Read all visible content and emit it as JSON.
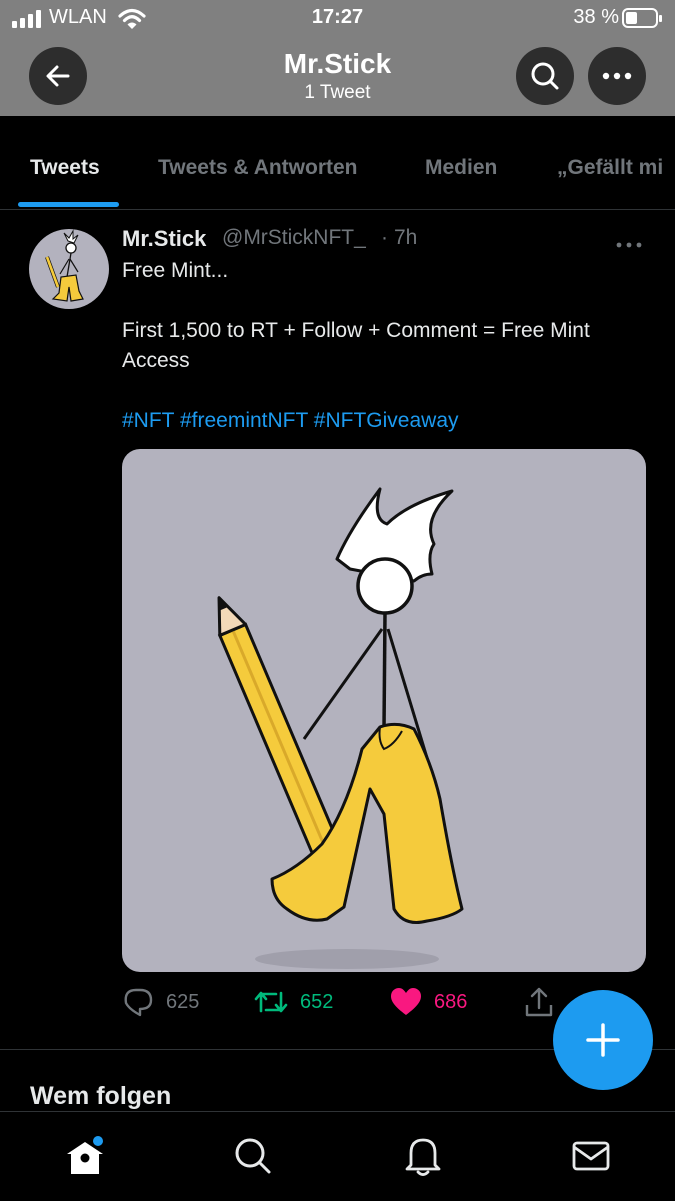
{
  "status_bar": {
    "carrier": "WLAN",
    "time": "17:27",
    "battery": "38 %"
  },
  "header": {
    "title": "Mr.Stick",
    "subtitle": "1 Tweet"
  },
  "tabs": [
    {
      "label": "Tweets",
      "active": true
    },
    {
      "label": "Tweets & Antworten",
      "active": false
    },
    {
      "label": "Medien",
      "active": false
    },
    {
      "label": "„Gefällt mi",
      "active": false
    }
  ],
  "tweet": {
    "author_name": "Mr.Stick",
    "author_handle": "@MrStickNFT_",
    "separator": "·",
    "time": "7h",
    "text_line1": "Free Mint...",
    "text_line2": "First 1,500 to RT + Follow + Comment = Free Mint",
    "text_line3": "Access",
    "hashtags": [
      "#NFT",
      "#freemintNFT",
      "#NFTGiveaway"
    ],
    "replies": "625",
    "retweets": "652",
    "likes": "686"
  },
  "section": {
    "title": "Wem folgen"
  },
  "colors": {
    "accent": "#1d9bf0",
    "retweet": "#00ba7c",
    "like": "#f91880",
    "media_bg": "#b3b2be"
  },
  "icons": {
    "back": "arrow-left-icon",
    "search": "search-icon",
    "more": "more-icon",
    "reply": "reply-icon",
    "retweet": "retweet-icon",
    "like": "heart-icon",
    "share": "share-icon",
    "compose": "plus-icon",
    "nav": [
      "home-icon",
      "search-icon",
      "bell-icon",
      "mail-icon"
    ]
  }
}
